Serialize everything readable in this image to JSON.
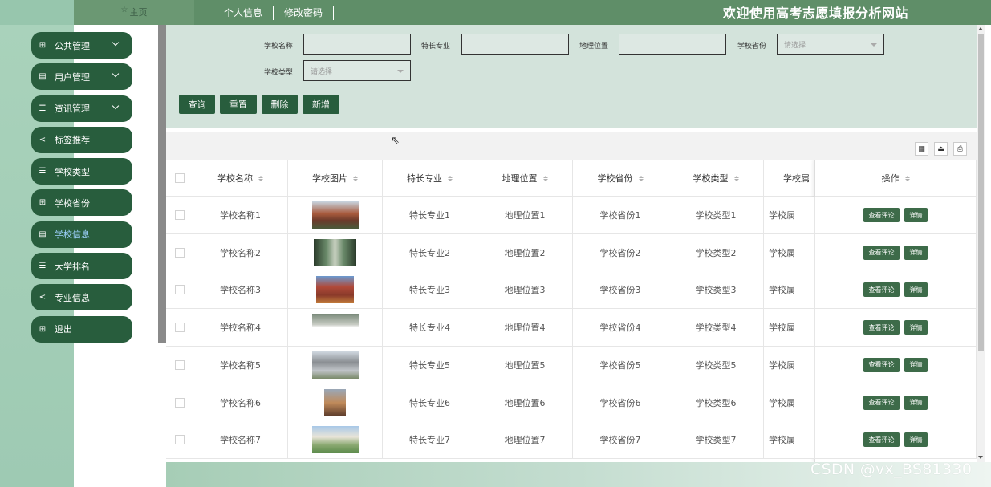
{
  "topbar": {
    "home_label": "主页",
    "links": [
      "个人信息",
      "修改密码"
    ],
    "site_title": "欢迎使用高考志愿填报分析网站"
  },
  "sidebar": {
    "items": [
      {
        "label": "公共管理",
        "icon": "grid-icon",
        "expandable": true
      },
      {
        "label": "用户管理",
        "icon": "book-icon",
        "expandable": true
      },
      {
        "label": "资讯管理",
        "icon": "list-icon",
        "expandable": true
      },
      {
        "label": "标签推荐",
        "icon": "share-icon",
        "expandable": false
      },
      {
        "label": "学校类型",
        "icon": "list-icon",
        "expandable": false
      },
      {
        "label": "学校省份",
        "icon": "grid-icon",
        "expandable": false
      },
      {
        "label": "学校信息",
        "icon": "book-icon",
        "expandable": false,
        "active": true
      },
      {
        "label": "大学排名",
        "icon": "list-icon",
        "expandable": false
      },
      {
        "label": "专业信息",
        "icon": "share-icon",
        "expandable": false
      },
      {
        "label": "退出",
        "icon": "grid-icon",
        "expandable": false
      }
    ]
  },
  "search": {
    "school_name_label": "学校名称",
    "specialty_label": "特长专业",
    "location_label": "地理位置",
    "province_label": "学校省份",
    "province_placeholder": "请选择",
    "type_label": "学校类型",
    "type_placeholder": "请选择",
    "buttons": {
      "query": "查询",
      "reset": "重置",
      "delete": "删除",
      "add": "新增"
    }
  },
  "table": {
    "columns": [
      "学校名称",
      "学校图片",
      "特长专业",
      "地理位置",
      "学校省份",
      "学校类型",
      "学校属",
      "操作"
    ],
    "op_buttons": {
      "comments": "查看评论",
      "detail": "详情"
    },
    "rows": [
      {
        "name": "学校名称1",
        "specialty": "特长专业1",
        "location": "地理位置1",
        "province": "学校省份1",
        "type": "学校类型1",
        "attr": "学校属"
      },
      {
        "name": "学校名称2",
        "specialty": "特长专业2",
        "location": "地理位置2",
        "province": "学校省份2",
        "type": "学校类型2",
        "attr": "学校属"
      },
      {
        "name": "学校名称3",
        "specialty": "特长专业3",
        "location": "地理位置3",
        "province": "学校省份3",
        "type": "学校类型3",
        "attr": "学校属"
      },
      {
        "name": "学校名称4",
        "specialty": "特长专业4",
        "location": "地理位置4",
        "province": "学校省份4",
        "type": "学校类型4",
        "attr": "学校属"
      },
      {
        "name": "学校名称5",
        "specialty": "特长专业5",
        "location": "地理位置5",
        "province": "学校省份5",
        "type": "学校类型5",
        "attr": "学校属"
      },
      {
        "name": "学校名称6",
        "specialty": "特长专业6",
        "location": "地理位置6",
        "province": "学校省份6",
        "type": "学校类型6",
        "attr": "学校属"
      },
      {
        "name": "学校名称7",
        "specialty": "特长专业7",
        "location": "地理位置7",
        "province": "学校省份7",
        "type": "学校类型7",
        "attr": "学校属"
      }
    ]
  },
  "watermark": "CSDN @vx_BS81330",
  "colors": {
    "topbar": "#5f8e68",
    "accent": "#285d3d",
    "search_panel": "#d3e3db",
    "sidebar_bg": "#a9d2bb"
  }
}
